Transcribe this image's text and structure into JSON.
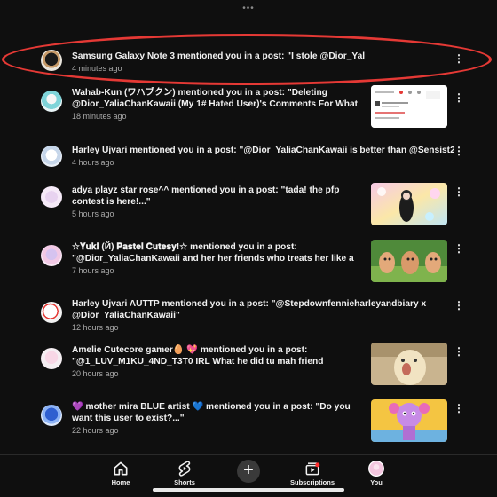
{
  "top_handle": "•••",
  "notifications": [
    {
      "message": "Samsung Galaxy Note 3 mentioned you in a post: \"I stole @Dior_YaliaChanKawaii's handle!\"",
      "time": "4 minutes ago",
      "has_thumbnail": false,
      "highlighted": true
    },
    {
      "message": "Wahab-Kun (ワハブクン) mentioned you in a post: \"Deleting @Dior_YaliaChanKawaii (My 1# Hated User)'s Comments For What Sh...",
      "time": "18 minutes ago",
      "has_thumbnail": true
    },
    {
      "message": "Harley Ujvari mentioned you in a post: \"@Dior_YaliaChanKawaii is better than @Sensist2011\"",
      "time": "4 hours ago",
      "has_thumbnail": false
    },
    {
      "message": "adya playz star rose^^ mentioned you in a post: \"tada! the pfp contest is here!...\"",
      "time": "5 hours ago",
      "has_thumbnail": true
    },
    {
      "message": "☆𝐘𝐮𝐤𝐢 (Й) 𝐏𝐚𝐬𝐭𝐞𝐥 𝐂𝐮𝐭𝐞𝐬𝐲!☆ mentioned you in a post: \"@Dior_YaliaChanKawaii and her her friends who treats her like a God...",
      "time": "7 hours ago",
      "has_thumbnail": true
    },
    {
      "message": "Harley Ujvari AUTTP mentioned you in a post: \"@Stepdownfennieharleyandbiary x @Dior_YaliaChanKawaii\"",
      "time": "12 hours ago",
      "has_thumbnail": false
    },
    {
      "message": "Amelie Cutecore gamer🥚 💖 mentioned you in a post: \"@1_LUV_M1KU_4ND_T3T0 IRL What he did tu mah friend @Dior_Yali...",
      "time": "20 hours ago",
      "has_thumbnail": true
    },
    {
      "message": "💜 mother mira BLUE artist 💙 mentioned you in a post: \"Do you want this user to exist?...\"",
      "time": "22 hours ago",
      "has_thumbnail": true
    }
  ],
  "bottom_nav": {
    "home": "Home",
    "shorts": "Shorts",
    "create": "+",
    "subscriptions": "Subscriptions",
    "you": "You"
  },
  "colors": {
    "background": "#0f0f0f",
    "text": "#f1f1f1",
    "secondary_text": "#aaaaaa",
    "annotation_red": "#e53935"
  },
  "icons": [
    "more-vert-icon",
    "home-icon",
    "shorts-icon",
    "plus-icon",
    "subscriptions-icon",
    "you-avatar-icon"
  ]
}
